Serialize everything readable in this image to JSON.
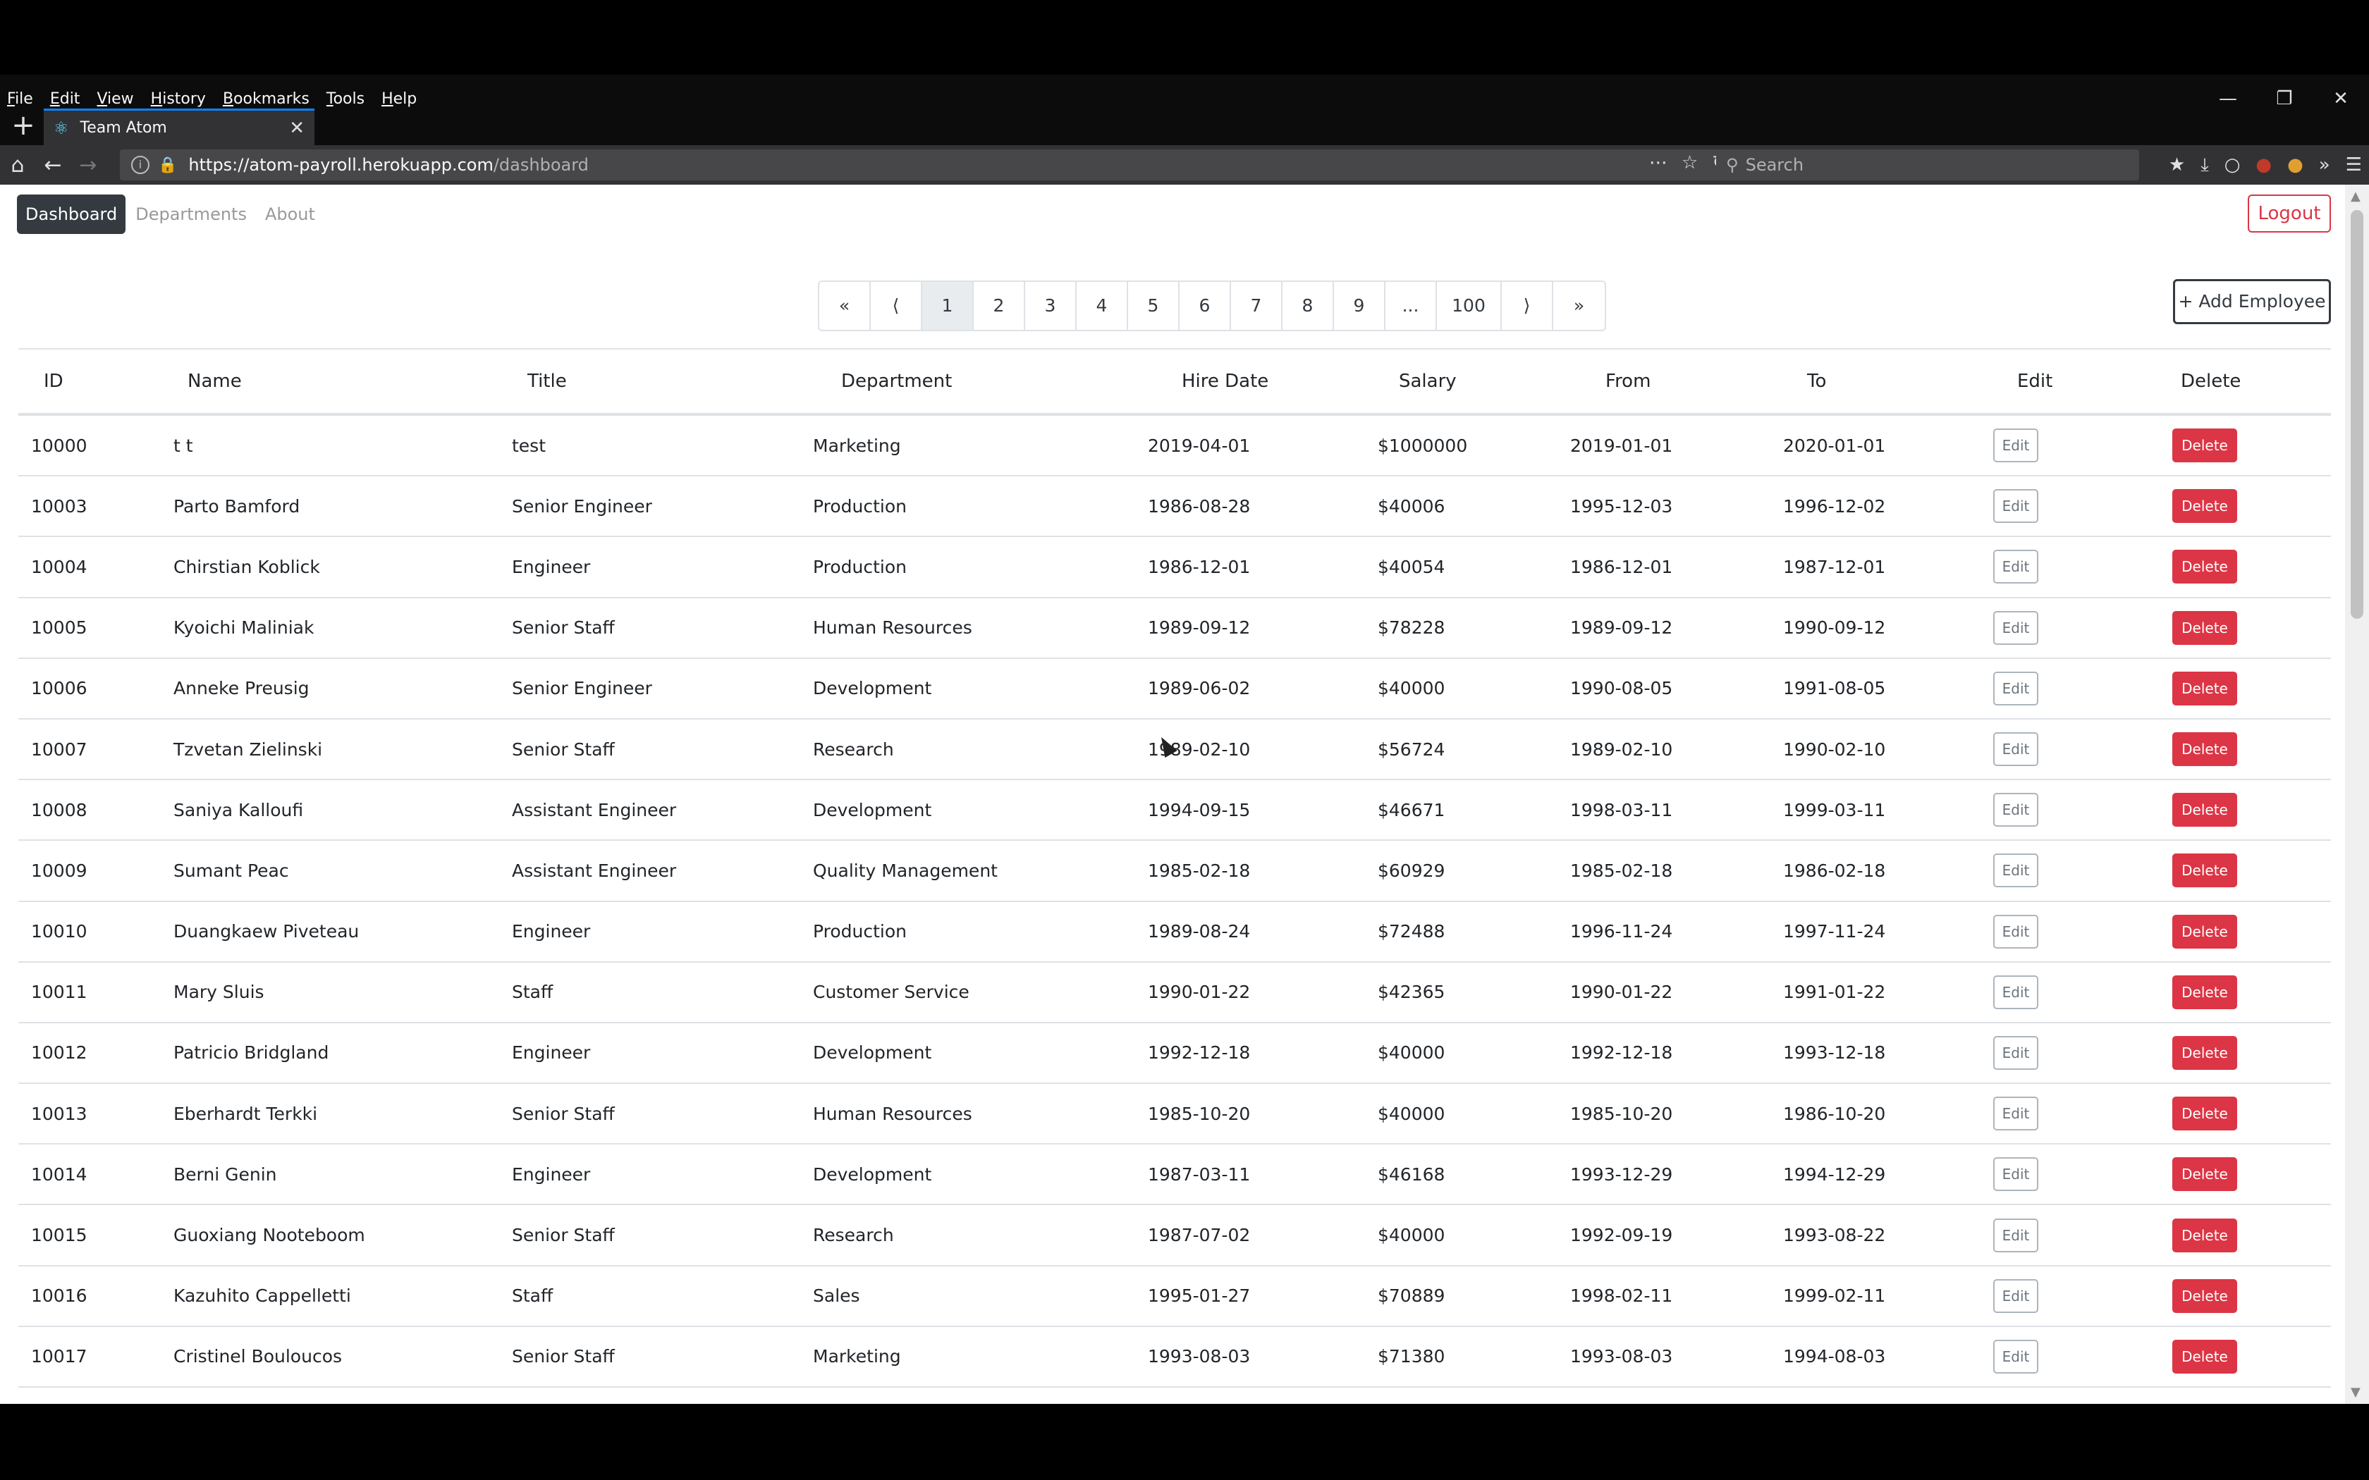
{
  "browser": {
    "menu": [
      "File",
      "Edit",
      "View",
      "History",
      "Bookmarks",
      "Tools",
      "Help"
    ],
    "tab_title": "Team Atom",
    "url_domain": "https://atom-payroll.herokuapp.com",
    "url_path": "/dashboard",
    "search_placeholder": "Search"
  },
  "app": {
    "nav": [
      "Dashboard",
      "Departments",
      "About"
    ],
    "active_nav": "Dashboard",
    "logout_label": "Logout",
    "add_employee_label": "+ Add Employee",
    "pagination": [
      "«",
      "⟨",
      "1",
      "2",
      "3",
      "4",
      "5",
      "6",
      "7",
      "8",
      "9",
      "...",
      "100",
      "⟩",
      "»"
    ],
    "current_page": "1"
  },
  "table": {
    "headers": [
      "ID",
      "Name",
      "Title",
      "Department",
      "Hire Date",
      "Salary",
      "From",
      "To",
      "Edit",
      "Delete"
    ],
    "edit_label": "Edit",
    "delete_label": "Delete",
    "rows": [
      [
        "10000",
        "t t",
        "test",
        "Marketing",
        "2019-04-01",
        "$1000000",
        "2019-01-01",
        "2020-01-01"
      ],
      [
        "10003",
        "Parto Bamford",
        "Senior Engineer",
        "Production",
        "1986-08-28",
        "$40006",
        "1995-12-03",
        "1996-12-02"
      ],
      [
        "10004",
        "Chirstian Koblick",
        "Engineer",
        "Production",
        "1986-12-01",
        "$40054",
        "1986-12-01",
        "1987-12-01"
      ],
      [
        "10005",
        "Kyoichi Maliniak",
        "Senior Staff",
        "Human Resources",
        "1989-09-12",
        "$78228",
        "1989-09-12",
        "1990-09-12"
      ],
      [
        "10006",
        "Anneke Preusig",
        "Senior Engineer",
        "Development",
        "1989-06-02",
        "$40000",
        "1990-08-05",
        "1991-08-05"
      ],
      [
        "10007",
        "Tzvetan Zielinski",
        "Senior Staff",
        "Research",
        "1989-02-10",
        "$56724",
        "1989-02-10",
        "1990-02-10"
      ],
      [
        "10008",
        "Saniya Kalloufi",
        "Assistant Engineer",
        "Development",
        "1994-09-15",
        "$46671",
        "1998-03-11",
        "1999-03-11"
      ],
      [
        "10009",
        "Sumant Peac",
        "Assistant Engineer",
        "Quality Management",
        "1985-02-18",
        "$60929",
        "1985-02-18",
        "1986-02-18"
      ],
      [
        "10010",
        "Duangkaew Piveteau",
        "Engineer",
        "Production",
        "1989-08-24",
        "$72488",
        "1996-11-24",
        "1997-11-24"
      ],
      [
        "10011",
        "Mary Sluis",
        "Staff",
        "Customer Service",
        "1990-01-22",
        "$42365",
        "1990-01-22",
        "1991-01-22"
      ],
      [
        "10012",
        "Patricio Bridgland",
        "Engineer",
        "Development",
        "1992-12-18",
        "$40000",
        "1992-12-18",
        "1993-12-18"
      ],
      [
        "10013",
        "Eberhardt Terkki",
        "Senior Staff",
        "Human Resources",
        "1985-10-20",
        "$40000",
        "1985-10-20",
        "1986-10-20"
      ],
      [
        "10014",
        "Berni Genin",
        "Engineer",
        "Development",
        "1987-03-11",
        "$46168",
        "1993-12-29",
        "1994-12-29"
      ],
      [
        "10015",
        "Guoxiang Nooteboom",
        "Senior Staff",
        "Research",
        "1987-07-02",
        "$40000",
        "1992-09-19",
        "1993-08-22"
      ],
      [
        "10016",
        "Kazuhito Cappelletti",
        "Staff",
        "Sales",
        "1995-01-27",
        "$70889",
        "1998-02-11",
        "1999-02-11"
      ],
      [
        "10017",
        "Cristinel Bouloucos",
        "Senior Staff",
        "Marketing",
        "1993-08-03",
        "$71380",
        "1993-08-03",
        "1994-08-03"
      ]
    ]
  }
}
